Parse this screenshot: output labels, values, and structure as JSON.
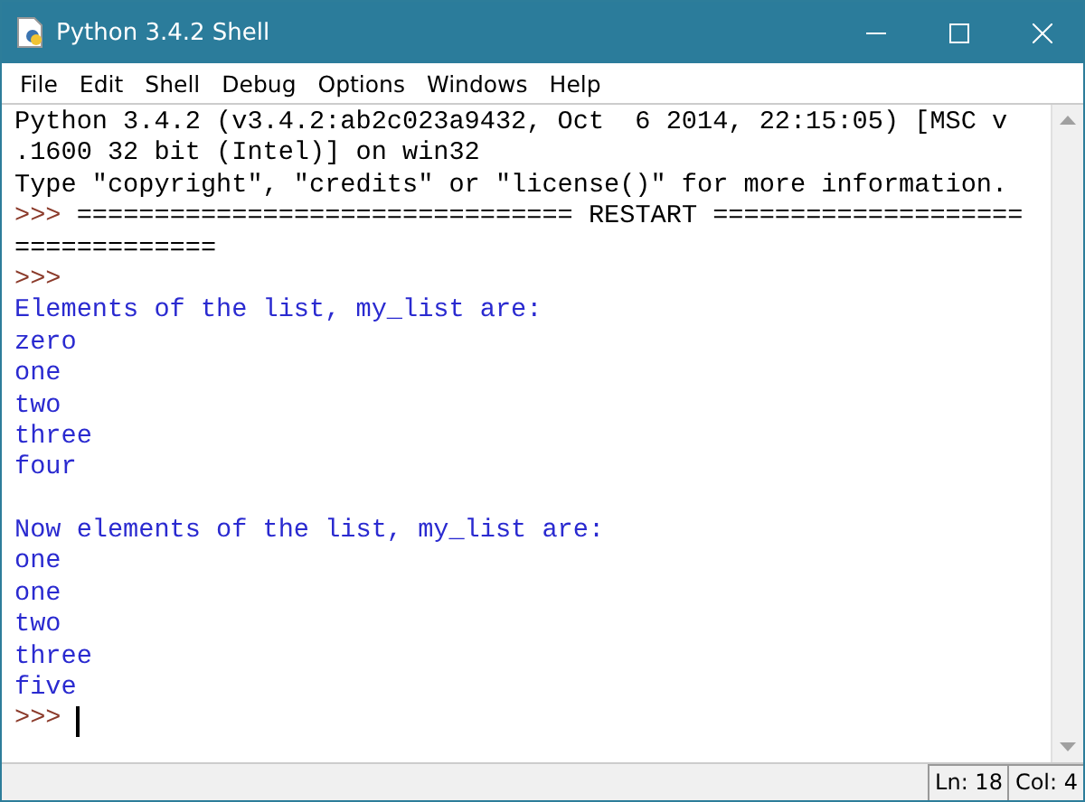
{
  "window": {
    "title": "Python 3.4.2 Shell"
  },
  "menu": [
    "File",
    "Edit",
    "Shell",
    "Debug",
    "Options",
    "Windows",
    "Help"
  ],
  "lines": [
    {
      "kind": "info",
      "text": "Python 3.4.2 (v3.4.2:ab2c023a9432, Oct  6 2014, 22:15:05) [MSC v"
    },
    {
      "kind": "info",
      "text": ".1600 32 bit (Intel)] on win32"
    },
    {
      "kind": "info",
      "text": "Type \"copyright\", \"credits\" or \"license()\" for more information."
    },
    {
      "kind": "prompt",
      "prompt": ">>>",
      "text": "================================ RESTART ===================="
    },
    {
      "kind": "info",
      "text": "============="
    },
    {
      "kind": "prompt",
      "prompt": ">>>"
    },
    {
      "kind": "output",
      "text": "Elements of the list, my_list are:"
    },
    {
      "kind": "output",
      "text": "zero"
    },
    {
      "kind": "output",
      "text": "one"
    },
    {
      "kind": "output",
      "text": "two"
    },
    {
      "kind": "output",
      "text": "three"
    },
    {
      "kind": "output",
      "text": "four"
    },
    {
      "kind": "blank"
    },
    {
      "kind": "output",
      "text": "Now elements of the list, my_list are:"
    },
    {
      "kind": "output",
      "text": "one"
    },
    {
      "kind": "output",
      "text": "one"
    },
    {
      "kind": "output",
      "text": "two"
    },
    {
      "kind": "output",
      "text": "three"
    },
    {
      "kind": "output",
      "text": "five"
    },
    {
      "kind": "prompt",
      "prompt": ">>>",
      "cursor": true
    }
  ],
  "status_bar": {
    "line": "Ln: 18",
    "column": "Col: 4"
  }
}
